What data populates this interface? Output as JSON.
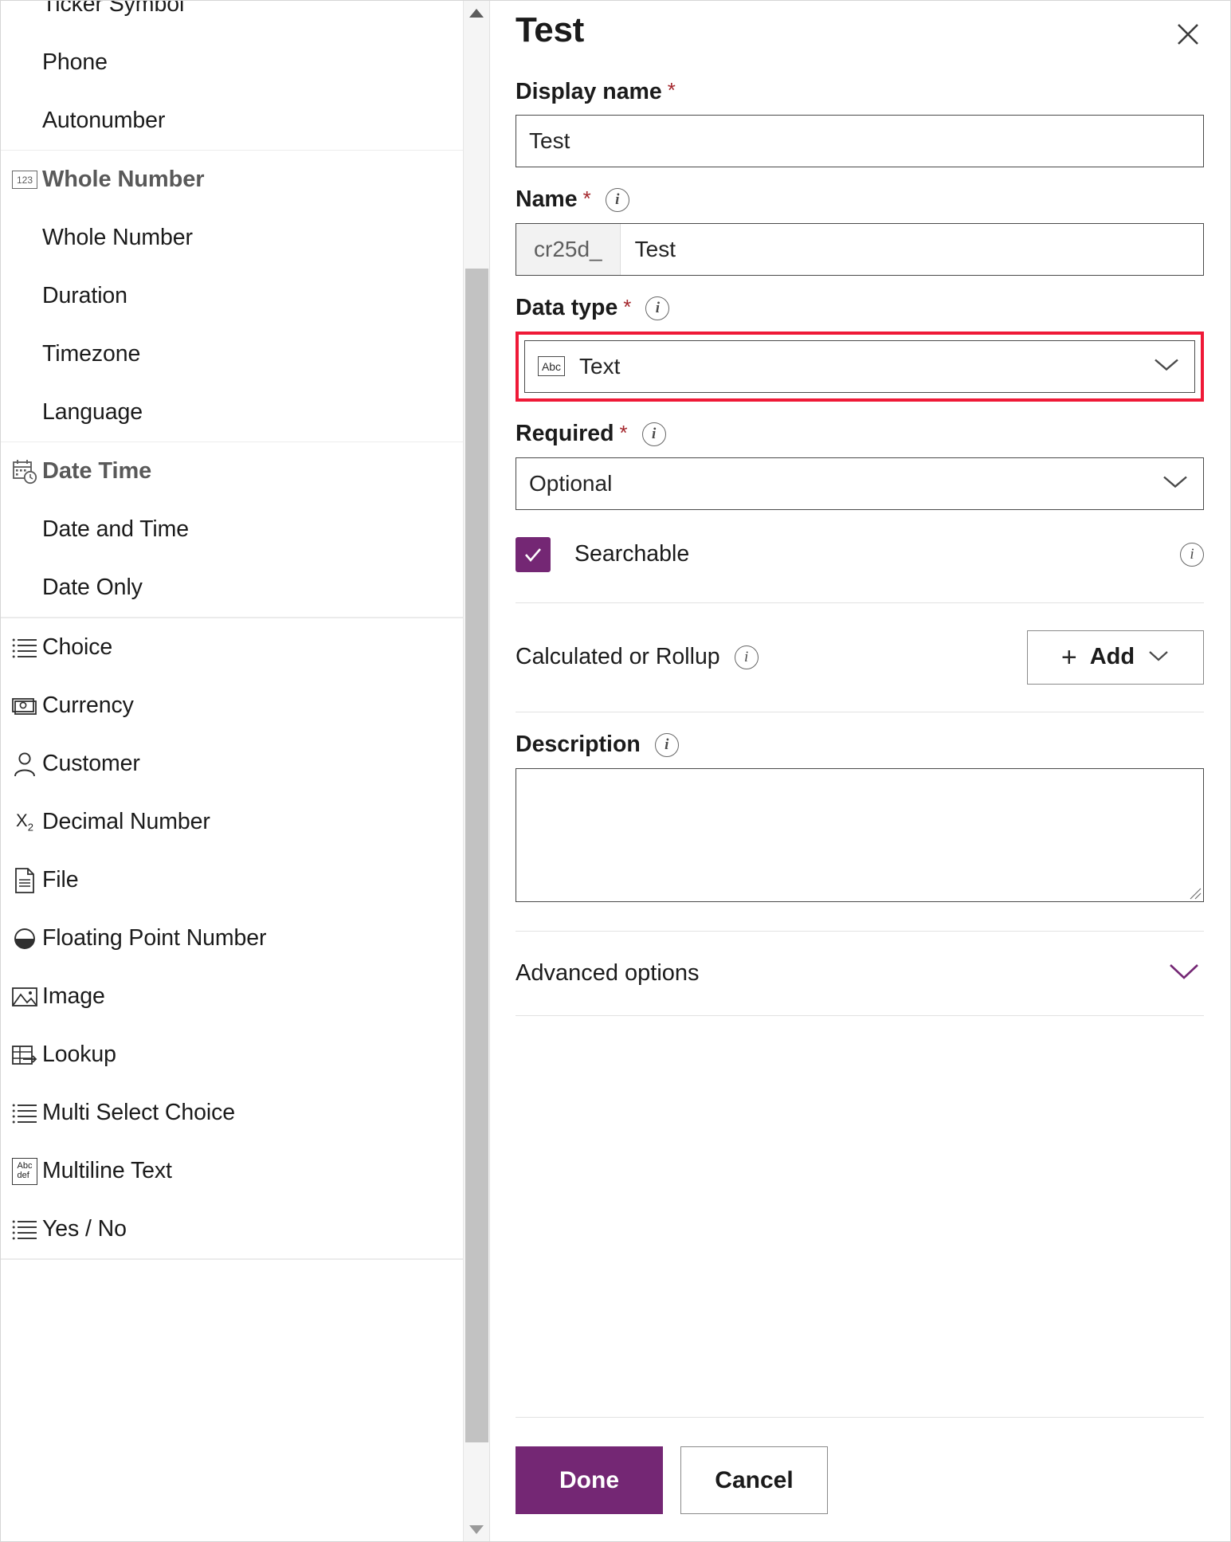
{
  "type_list": {
    "groups": [
      {
        "name": "text-group-partial",
        "items": [
          {
            "label": "Ticker Symbol",
            "icon": "",
            "kind": "sub",
            "clipped": true
          },
          {
            "label": "Phone",
            "icon": "",
            "kind": "sub"
          },
          {
            "label": "Autonumber",
            "icon": "",
            "kind": "sub"
          }
        ]
      },
      {
        "name": "whole-number-group",
        "items": [
          {
            "label": "Whole Number",
            "icon": "123-box-icon",
            "kind": "header"
          },
          {
            "label": "Whole Number",
            "icon": "",
            "kind": "sub"
          },
          {
            "label": "Duration",
            "icon": "",
            "kind": "sub"
          },
          {
            "label": "Timezone",
            "icon": "",
            "kind": "sub"
          },
          {
            "label": "Language",
            "icon": "",
            "kind": "sub"
          }
        ]
      },
      {
        "name": "date-time-group",
        "items": [
          {
            "label": "Date Time",
            "icon": "calendar-clock-icon",
            "kind": "header"
          },
          {
            "label": "Date and Time",
            "icon": "",
            "kind": "sub"
          },
          {
            "label": "Date Only",
            "icon": "",
            "kind": "sub"
          }
        ]
      },
      {
        "name": "other-types-group",
        "items": [
          {
            "label": "Choice",
            "icon": "list-icon",
            "kind": "item"
          },
          {
            "label": "Currency",
            "icon": "currency-icon",
            "kind": "item"
          },
          {
            "label": "Customer",
            "icon": "person-icon",
            "kind": "item"
          },
          {
            "label": "Decimal Number",
            "icon": "subscript-x2-icon",
            "kind": "item"
          },
          {
            "label": "File",
            "icon": "file-icon",
            "kind": "item"
          },
          {
            "label": "Floating Point Number",
            "icon": "half-filled-circle-icon",
            "kind": "item"
          },
          {
            "label": "Image",
            "icon": "image-icon",
            "kind": "item"
          },
          {
            "label": "Lookup",
            "icon": "lookup-table-arrow-icon",
            "kind": "item"
          },
          {
            "label": "Multi Select Choice",
            "icon": "list-icon",
            "kind": "item"
          },
          {
            "label": "Multiline Text",
            "icon": "abc-def-box-icon",
            "kind": "item"
          },
          {
            "label": "Yes / No",
            "icon": "list-icon",
            "kind": "item"
          }
        ]
      }
    ]
  },
  "scrollbar": {
    "up_arrow": "scroll-up-arrow",
    "down_arrow": "scroll-down-arrow"
  },
  "panel": {
    "title": "Test",
    "close_label": "Close",
    "display_name": {
      "label": "Display name",
      "required_marker": "*",
      "value": "Test",
      "placeholder": "Test"
    },
    "name": {
      "label": "Name",
      "required_marker": "*",
      "prefix": "cr25d_",
      "value": "Test",
      "placeholder": "Test"
    },
    "data_type": {
      "label": "Data type",
      "required_marker": "*",
      "selected": "Text",
      "icon_text": "Abc",
      "highlight_color": "#ef1937"
    },
    "required": {
      "label": "Required",
      "required_marker": "*",
      "selected": "Optional"
    },
    "searchable": {
      "label": "Searchable",
      "checked": true,
      "accent_color": "#742774"
    },
    "calculated_or_rollup": {
      "label": "Calculated or Rollup",
      "add_label": "Add"
    },
    "description": {
      "label": "Description",
      "value": "",
      "placeholder": ""
    },
    "advanced_options": {
      "label": "Advanced options",
      "chevron_color": "#742774"
    },
    "footer": {
      "done_label": "Done",
      "cancel_label": "Cancel"
    }
  }
}
